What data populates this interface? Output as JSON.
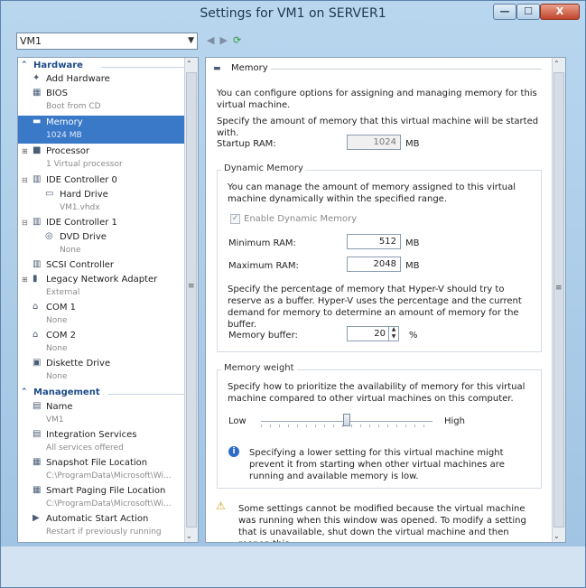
{
  "window": {
    "title": "Settings for VM1 on SERVER1",
    "minimize": "—",
    "maximize": "☐",
    "close": "X"
  },
  "toolbar": {
    "vm_selector": "VM1",
    "back_icon": "◀",
    "forward_icon": "▶",
    "refresh_icon": "⟳"
  },
  "sidebar": {
    "hardware_label": "Hardware",
    "management_label": "Management",
    "items": [
      {
        "label": "Add Hardware",
        "sub": ""
      },
      {
        "label": "BIOS",
        "sub": "Boot from CD"
      },
      {
        "label": "Memory",
        "sub": "1024 MB"
      },
      {
        "label": "Processor",
        "sub": "1 Virtual processor"
      },
      {
        "label": "IDE Controller 0",
        "sub": ""
      },
      {
        "label": "Hard Drive",
        "sub": "VM1.vhdx"
      },
      {
        "label": "IDE Controller 1",
        "sub": ""
      },
      {
        "label": "DVD Drive",
        "sub": "None"
      },
      {
        "label": "SCSI Controller",
        "sub": ""
      },
      {
        "label": "Legacy Network Adapter",
        "sub": "External"
      },
      {
        "label": "COM 1",
        "sub": "None"
      },
      {
        "label": "COM 2",
        "sub": "None"
      },
      {
        "label": "Diskette Drive",
        "sub": "None"
      }
    ],
    "management_items": [
      {
        "label": "Name",
        "sub": "VM1"
      },
      {
        "label": "Integration Services",
        "sub": "All services offered"
      },
      {
        "label": "Snapshot File Location",
        "sub": "C:\\ProgramData\\Microsoft\\Wi..."
      },
      {
        "label": "Smart Paging File Location",
        "sub": "C:\\ProgramData\\Microsoft\\Wi..."
      },
      {
        "label": "Automatic Start Action",
        "sub": "Restart if previously running"
      }
    ]
  },
  "memory": {
    "heading": "Memory",
    "intro": "You can configure options for assigning and managing memory for this virtual machine.",
    "specify": "Specify the amount of memory that this virtual machine will be started with.",
    "startup_label": "Startup RAM:",
    "startup_value": "1024",
    "unit": "MB",
    "dynamic": {
      "title": "Dynamic Memory",
      "desc": "You can manage the amount of memory assigned to this virtual machine dynamically within the specified range.",
      "enable_label": "Enable Dynamic Memory",
      "enabled": true,
      "min_label": "Minimum RAM:",
      "min_value": "512",
      "max_label": "Maximum RAM:",
      "max_value": "2048",
      "buffer_desc": "Specify the percentage of memory that Hyper-V should try to reserve as a buffer. Hyper-V uses the percentage and the current demand for memory to determine an amount of memory for the buffer.",
      "buffer_label": "Memory buffer:",
      "buffer_value": "20",
      "buffer_unit": "%"
    },
    "weight": {
      "title": "Memory weight",
      "desc": "Specify how to prioritize the availability of memory for this virtual machine compared to other virtual machines on this computer.",
      "low": "Low",
      "high": "High",
      "level": 0.5,
      "info": "Specifying a lower setting for this virtual machine might prevent it from starting when other virtual machines are running and available memory is low."
    },
    "warning": "Some settings cannot be modified because the virtual machine was running when this window was opened. To modify a setting that is unavailable, shut down the virtual machine and then reopen this"
  }
}
